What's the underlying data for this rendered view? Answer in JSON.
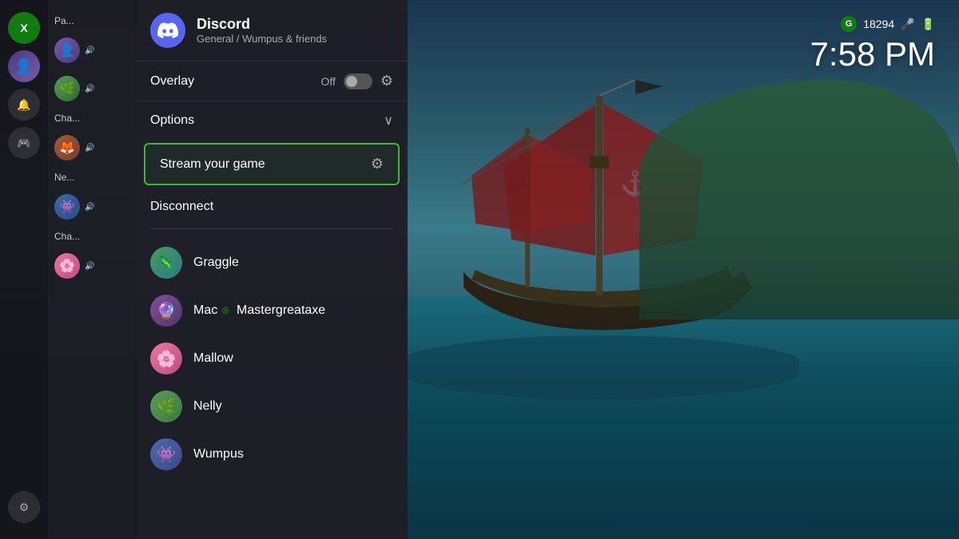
{
  "background": {
    "alt": "Sea of Thieves pirate ship scene"
  },
  "status_bar": {
    "g_label": "G",
    "score": "18294",
    "time": "7:58 PM"
  },
  "discord_panel": {
    "app_name": "Discord",
    "subtitle": "General / Wumpus & friends",
    "overlay_label": "Overlay",
    "overlay_state": "Off",
    "options_label": "Options",
    "stream_label": "Stream your game",
    "disconnect_label": "Disconnect"
  },
  "members": [
    {
      "name": "Graggle",
      "avatar_class": "av-graggle",
      "emoji": "🦎",
      "xbox": false
    },
    {
      "name": "Mac",
      "avatar_class": "av-mac",
      "emoji": "🔮",
      "xbox": true,
      "gamertag": "Mastergreataxe"
    },
    {
      "name": "Mallow",
      "avatar_class": "av-mallow",
      "emoji": "🌸",
      "xbox": false
    },
    {
      "name": "Nelly",
      "avatar_class": "av-nelly",
      "emoji": "🌿",
      "xbox": false
    },
    {
      "name": "Wumpus",
      "avatar_class": "av-wumpus",
      "emoji": "👾",
      "xbox": false
    }
  ],
  "channels": [
    {
      "label": "Pa..."
    },
    {
      "label": "Cha..."
    },
    {
      "label": "Ne..."
    },
    {
      "label": "Cha..."
    }
  ]
}
